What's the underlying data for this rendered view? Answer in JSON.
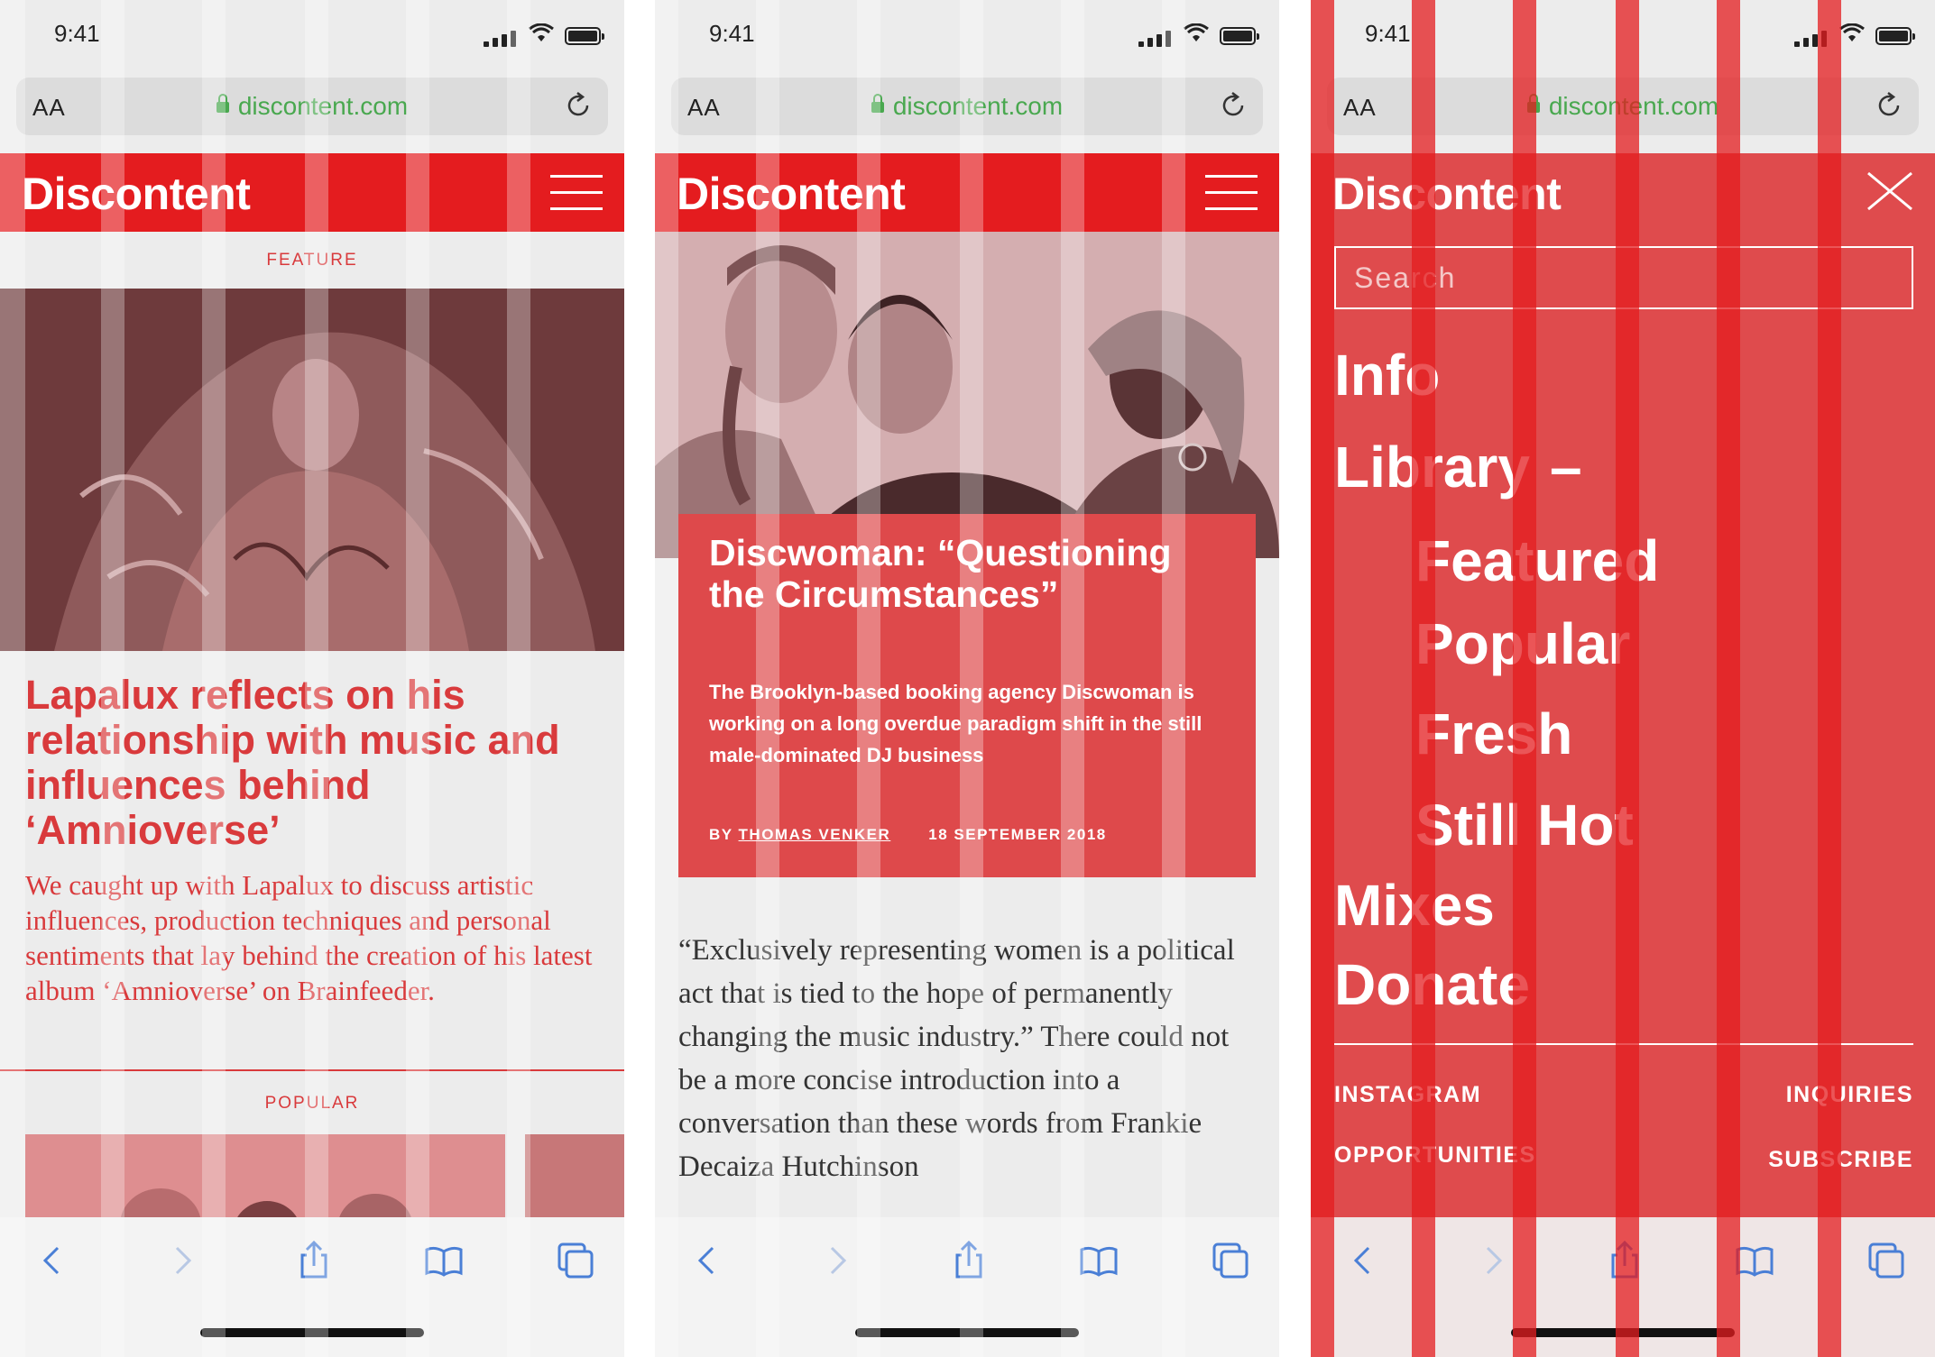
{
  "status": {
    "time": "9:41"
  },
  "browser": {
    "text_size": "AA",
    "url": "discontent.com"
  },
  "site": {
    "logo": "Discontent"
  },
  "screen1": {
    "section_feature": "FEATURE",
    "headline": "Lapalux reflects on his relationship with music and influences behind ‘Amnioverse’",
    "dek": "We caught up with Lapalux to discuss artistic influences, production techniques and personal sentiments that lay behind the creation of his latest album ‘Amnioverse’ on Brainfeeder.",
    "section_popular": "POPULAR"
  },
  "screen2": {
    "title": "Discwoman: “Questioning the Circumstances”",
    "dek": "The Brooklyn-based booking agency Discwoman is working on a long overdue paradigm shift in the still male-dominated DJ business",
    "by": "BY",
    "author": "THOMAS VENKER",
    "date": "18 SEPTEMBER 2018",
    "body": "“Exclusively representing women is a political act that is tied to the hope of permanently changing the music industry.” There could not be a more concise introduction into a conversation than these words from Frankie Decaiza Hutchinson"
  },
  "screen3": {
    "search_placeholder": "Search",
    "nav": {
      "info": "Info",
      "library": "Library",
      "library_toggle": "–",
      "featured": "Featured",
      "popular": "Popular",
      "fresh": "Fresh",
      "still_hot": "Still Hot",
      "mixes": "Mixes",
      "donate": "Donate"
    },
    "footer": {
      "instagram": "INSTAGRAM",
      "inquiries": "INQUIRIES",
      "opportunities": "OPPORTUNITIES",
      "subscribe": "SUBSCRIBE"
    }
  },
  "colors": {
    "brand_red": "#e41c1f",
    "card_red": "#de494b",
    "url_green": "#49a84f",
    "toolbar_blue": "#4a7fd6"
  },
  "icons": [
    "back-icon",
    "forward-icon",
    "share-icon",
    "bookmarks-icon",
    "tabs-icon",
    "reload-icon",
    "lock-icon",
    "menu-icon",
    "close-icon"
  ]
}
